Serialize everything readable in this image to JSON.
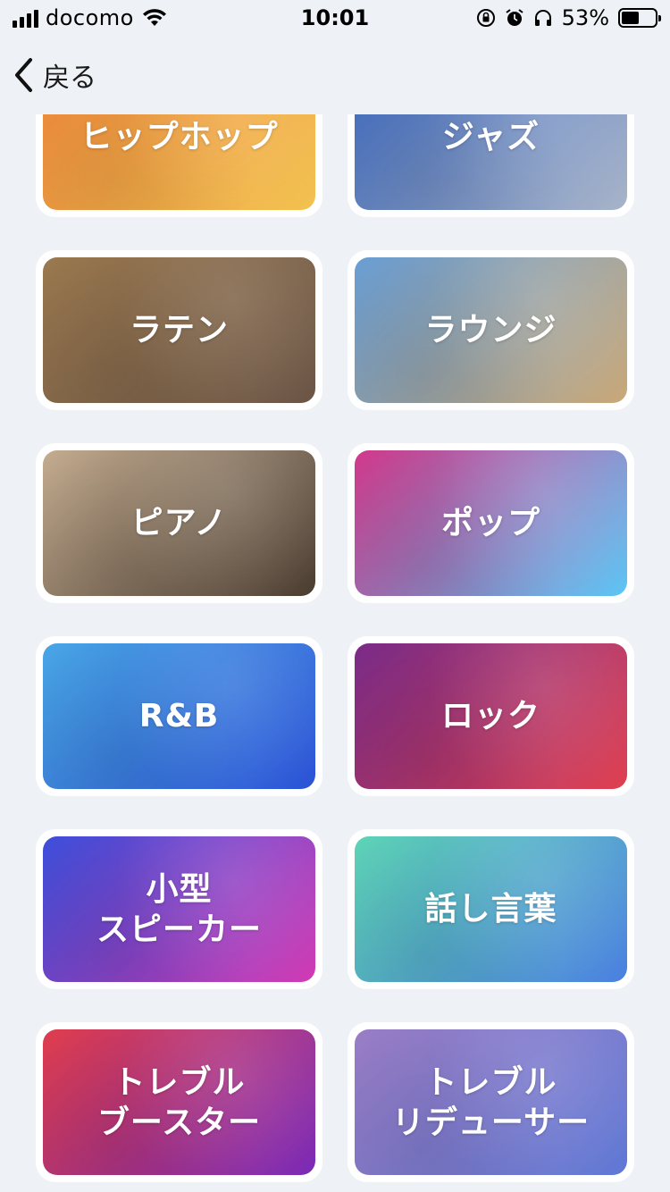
{
  "status": {
    "carrier": "docomo",
    "time": "10:01",
    "battery_percent": "53%",
    "battery_level": 0.53
  },
  "nav": {
    "back_label": "戻る"
  },
  "genres": [
    {
      "label": "ヒップホップ",
      "colors": [
        "#f28a3c",
        "#f2c24f"
      ]
    },
    {
      "label": "ジャズ",
      "colors": [
        "#3f6bc2",
        "#a8b4c8"
      ]
    },
    {
      "label": "ラテン",
      "colors": [
        "#9c7a50",
        "#6b5546"
      ]
    },
    {
      "label": "ラウンジ",
      "colors": [
        "#6a9fd6",
        "#c9a877"
      ]
    },
    {
      "label": "ピアノ",
      "colors": [
        "#c6ae92",
        "#4a3c30"
      ]
    },
    {
      "label": "ポップ",
      "colors": [
        "#d3398c",
        "#5cc6f5"
      ]
    },
    {
      "label": "R&B",
      "colors": [
        "#4aa8e8",
        "#2b52d6"
      ]
    },
    {
      "label": "ロック",
      "colors": [
        "#7b2c8a",
        "#e04050"
      ]
    },
    {
      "label": "小型\nスピーカー",
      "colors": [
        "#3d4fdc",
        "#d23ab3"
      ]
    },
    {
      "label": "話し言葉",
      "colors": [
        "#5fd6b8",
        "#4a80e0"
      ]
    },
    {
      "label": "トレブル\nブースター",
      "colors": [
        "#e23e4e",
        "#7a2ab8"
      ]
    },
    {
      "label": "トレブル\nリデューサー",
      "colors": [
        "#9c7ec8",
        "#5f78d4"
      ]
    }
  ]
}
